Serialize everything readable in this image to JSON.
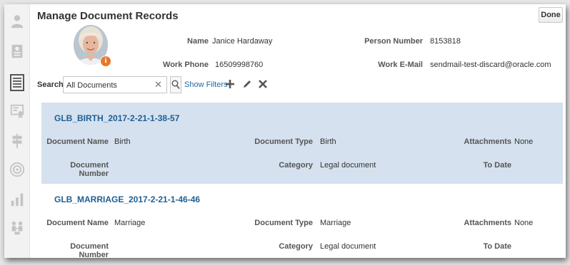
{
  "page": {
    "title": "Manage Document Records",
    "done_label": "Done"
  },
  "rail": [
    {
      "icon": "person-icon"
    },
    {
      "icon": "id-card-icon"
    },
    {
      "icon": "document-list-icon"
    },
    {
      "icon": "certificate-icon"
    },
    {
      "icon": "signpost-icon"
    },
    {
      "icon": "target-icon"
    },
    {
      "icon": "bar-chart-icon"
    },
    {
      "icon": "org-chart-icon"
    }
  ],
  "person": {
    "name_label": "Name",
    "name": "Janice Hardaway",
    "number_label": "Person Number",
    "number": "8153818",
    "phone_label": "Work Phone",
    "phone": "16509998760",
    "email_label": "Work E-Mail",
    "email": "sendmail-test-discard@oracle.com",
    "info_glyph": "i"
  },
  "search": {
    "label": "Search",
    "value": "All Documents",
    "clear_glyph": "✕",
    "show_filters": "Show Filters"
  },
  "labels": {
    "document_name": "Document Name",
    "document_type": "Document Type",
    "attachments": "Attachments",
    "document_number": "Document Number",
    "category": "Category",
    "to_date": "To Date"
  },
  "records": [
    {
      "title": "GLB_BIRTH_2017-2-21-1-38-57",
      "document_name": "Birth",
      "document_type": "Birth",
      "attachments": "None",
      "document_number": "",
      "category": "Legal document",
      "to_date": ""
    },
    {
      "title": "GLB_MARRIAGE_2017-2-21-1-46-46",
      "document_name": "Marriage",
      "document_type": "Marriage",
      "attachments": "None",
      "document_number": "",
      "category": "Legal document",
      "to_date": ""
    }
  ],
  "colors": {
    "link": "#1d6aa8",
    "selected_row": "#d5e1ee",
    "badge": "#e8782c"
  }
}
